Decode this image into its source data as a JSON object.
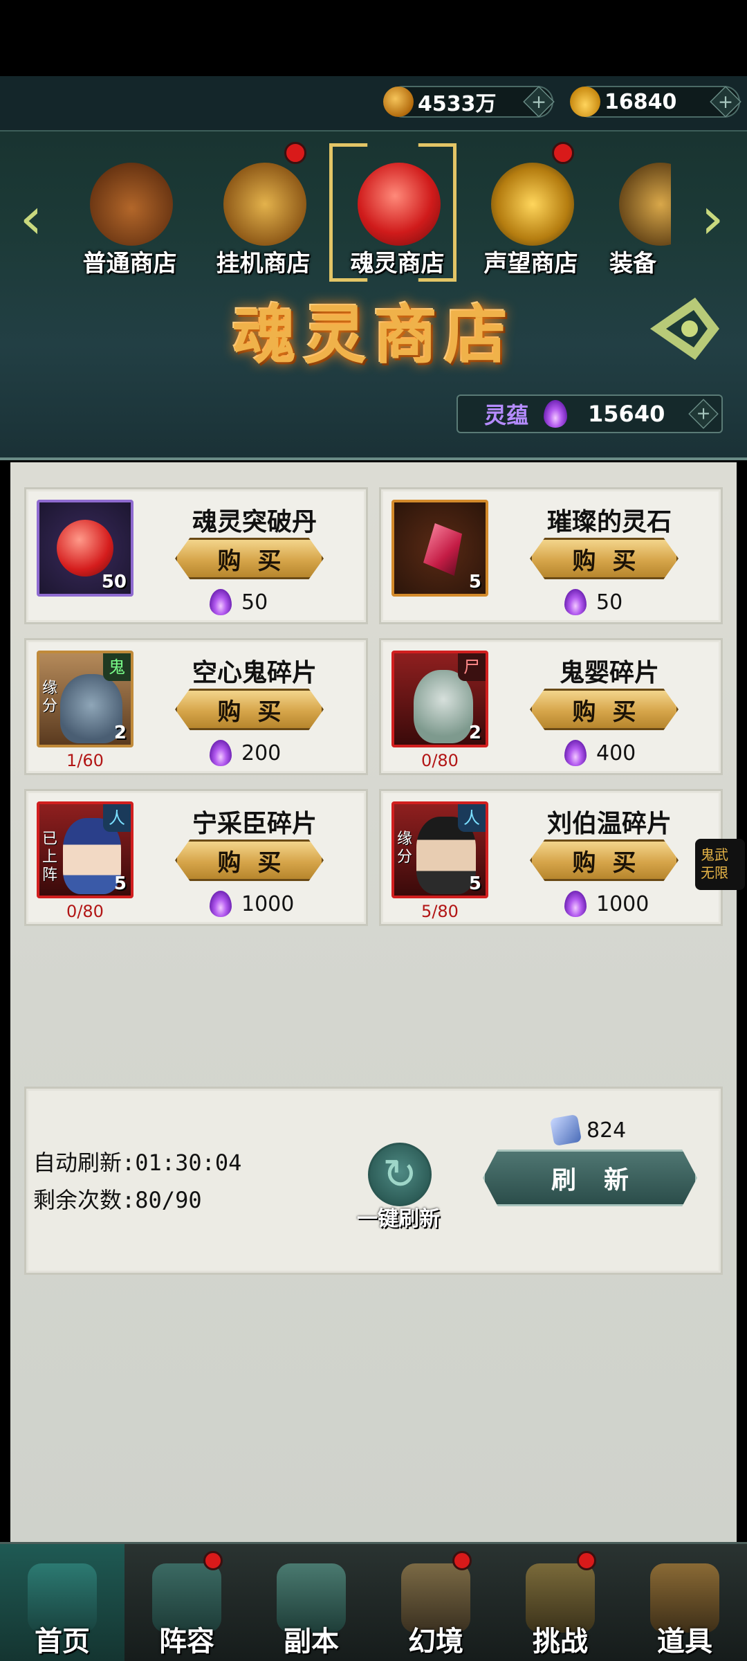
{
  "currencies": [
    {
      "name": "coin-icon",
      "value": "4533万"
    },
    {
      "name": "ingot-icon",
      "value": "16840"
    }
  ],
  "shop_tabs": [
    {
      "label": "普通商店",
      "selected": false,
      "badge": false
    },
    {
      "label": "挂机商店",
      "selected": false,
      "badge": true
    },
    {
      "label": "魂灵商店",
      "selected": true,
      "badge": false
    },
    {
      "label": "声望商店",
      "selected": false,
      "badge": true
    },
    {
      "label": "装备",
      "selected": false,
      "badge": false
    }
  ],
  "banner": {
    "title": "魂灵商店"
  },
  "spirit": {
    "label": "灵蕴",
    "value": "15640"
  },
  "buy_label": "购买",
  "items": [
    {
      "name": "魂灵突破丹",
      "qty": "50",
      "price": "50",
      "tag": "",
      "side": "",
      "progress": ""
    },
    {
      "name": "璀璨的灵石",
      "qty": "5",
      "price": "50",
      "tag": "",
      "side": "",
      "progress": ""
    },
    {
      "name": "空心鬼碎片",
      "qty": "2",
      "price": "200",
      "tag": "鬼",
      "side": "缘分",
      "progress": "1/60"
    },
    {
      "name": "鬼婴碎片",
      "qty": "2",
      "price": "400",
      "tag": "尸",
      "side": "",
      "progress": "0/80"
    },
    {
      "name": "宁采臣碎片",
      "qty": "5",
      "price": "1000",
      "tag": "人",
      "side": "已上阵",
      "progress": "0/80"
    },
    {
      "name": "刘伯温碎片",
      "qty": "5",
      "price": "1000",
      "tag": "人",
      "side": "缘分",
      "progress": "5/80"
    }
  ],
  "refresh": {
    "auto_label": "自动刷新:01:30:04",
    "remaining_label": "剩余次数:80/90",
    "onekey_label": "一键刷新",
    "cost": "824",
    "button_label": "刷新"
  },
  "side_badge": "鬼武无限",
  "bottom_nav": [
    {
      "label": "首页",
      "icon": "home-icon",
      "active": true,
      "badge": false
    },
    {
      "label": "阵容",
      "icon": "team-icon",
      "active": false,
      "badge": true
    },
    {
      "label": "副本",
      "icon": "dungeon-icon",
      "active": false,
      "badge": false
    },
    {
      "label": "幻境",
      "icon": "illusion-icon",
      "active": false,
      "badge": true
    },
    {
      "label": "挑战",
      "icon": "challenge-icon",
      "active": false,
      "badge": true
    },
    {
      "label": "道具",
      "icon": "items-icon",
      "active": false,
      "badge": false
    }
  ]
}
